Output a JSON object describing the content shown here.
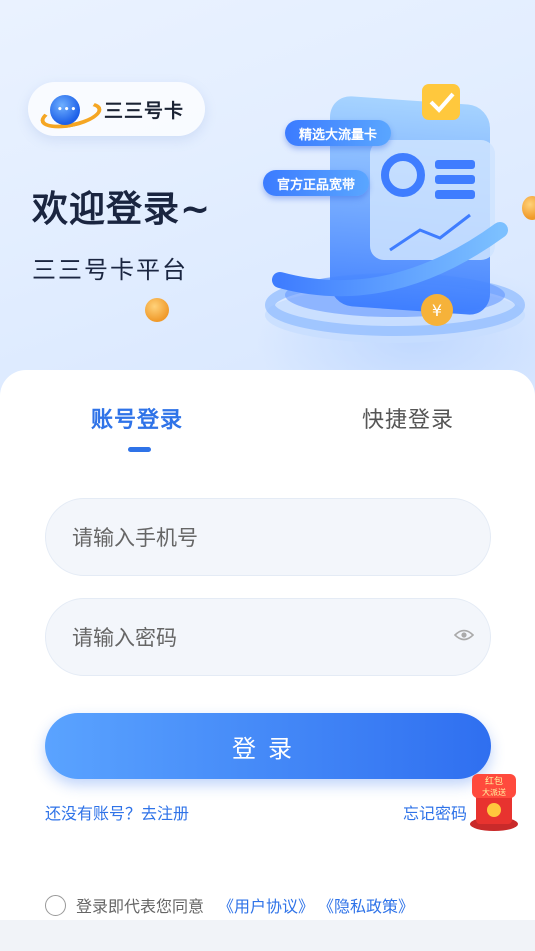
{
  "brand": {
    "name": "三三号卡",
    "logo_icon": "planet-chat-logo"
  },
  "hero": {
    "welcome": "欢迎登录~",
    "subtitle": "三三号卡平台",
    "tag1": "精选大流量卡",
    "tag2": "官方正品宽带"
  },
  "tabs": [
    {
      "label": "账号登录",
      "active": true
    },
    {
      "label": "快捷登录",
      "active": false
    }
  ],
  "form": {
    "phone_placeholder": "请输入手机号",
    "password_placeholder": "请输入密码",
    "eye_icon": "eye-icon",
    "login_label": "登录"
  },
  "links": {
    "register": "还没有账号？去注册",
    "forgot": "忘记密码"
  },
  "agreement": {
    "text": "登录即代表您同意",
    "user_agreement": "《用户协议》",
    "privacy_policy": "《隐私政策》"
  },
  "promo": {
    "line1": "红包",
    "line2": "大派送"
  },
  "colors": {
    "accent": "#2f73e8",
    "gold": "#f5a623"
  }
}
